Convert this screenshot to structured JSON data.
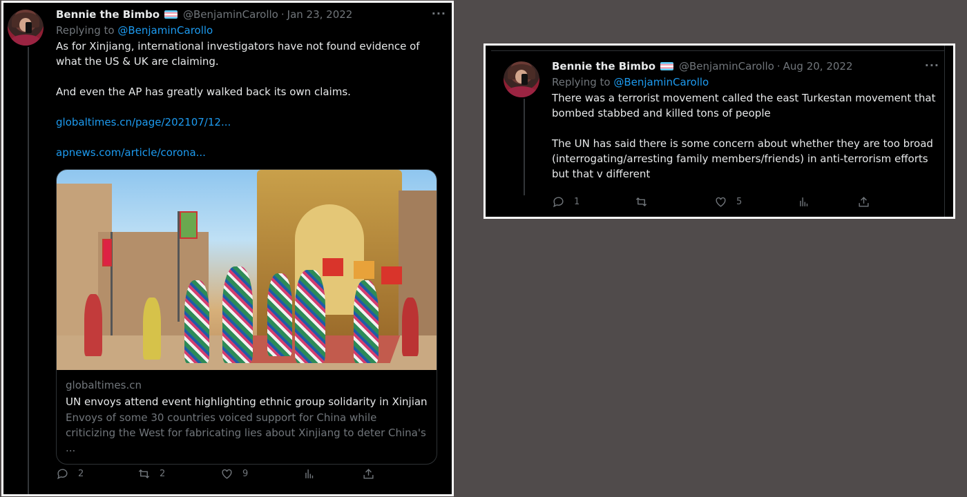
{
  "left_tweet": {
    "author_name": "Bennie the Bimbo",
    "handle": "@BenjaminCarollo",
    "separator": "·",
    "date": "Jan 23, 2022",
    "more_label": "···",
    "replying_prefix": "Replying to",
    "replying_to": "@BenjaminCarollo",
    "paragraph1": "As for Xinjiang, international investigators have not found evidence of what the US & UK are claiming.",
    "paragraph2": "And even the AP has greatly walked back its own claims.",
    "link1": "globaltimes.cn/page/202107/12...",
    "link2": "apnews.com/article/corona...",
    "card": {
      "domain": "globaltimes.cn",
      "title": "UN envoys attend event highlighting ethnic group solidarity in Xinjian...",
      "description": "Envoys of some 30 countries voiced support for China while criticizing the West for fabricating lies about Xinjiang to deter China's ..."
    },
    "actions": {
      "reply_count": "2",
      "retweet_count": "2",
      "like_count": "9"
    }
  },
  "right_tweet": {
    "author_name": "Bennie the Bimbo",
    "handle": "@BenjaminCarollo",
    "separator": "·",
    "date": "Aug 20, 2022",
    "more_label": "···",
    "replying_prefix": "Replying to",
    "replying_to": "@BenjaminCarollo",
    "paragraph1": "There was a terrorist movement called the east Turkestan movement that bombed stabbed and killed tons of people",
    "paragraph2": "The UN has said there is some concern about whether they are too broad (interrogating/arresting family members/friends) in anti-terrorism efforts but that v different",
    "actions": {
      "reply_count": "1",
      "like_count": "5"
    }
  },
  "icons": [
    "reply-icon",
    "retweet-icon",
    "like-icon",
    "views-icon",
    "share-icon",
    "more-icon",
    "trans-flag-icon"
  ],
  "colors": {
    "background": "#504b4b",
    "tweet_bg": "#000000",
    "link": "#1d9bf0",
    "muted": "#71767b",
    "text": "#e7e9ea"
  }
}
